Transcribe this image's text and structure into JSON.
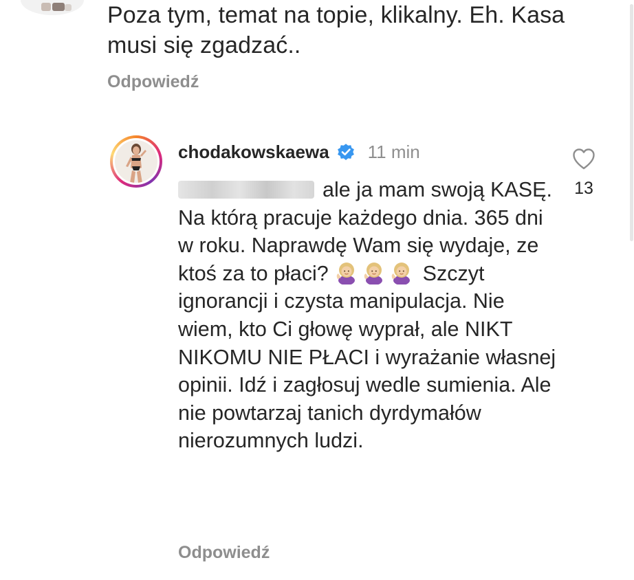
{
  "previous_comment": {
    "text": "Poza tym, temat na topie, klikalny. Eh. Kasa musi się zgadzać..",
    "reply_label": "Odpowiedź"
  },
  "comment": {
    "username": "chodakowskaewa",
    "timestamp": "11 min",
    "like_count": "13",
    "text_before_emoji": "ale ja mam swoją KASĘ. Na którą pracuje każdego dnia. 365 dni w roku. Naprawdę Wam się wydaje, ze ktoś za to płaci?",
    "emojis": [
      "woman-tipping-hand-emoji",
      "woman-tipping-hand-emoji",
      "woman-tipping-hand-emoji"
    ],
    "text_after_emoji": "Szczyt ignorancji i czysta manipulacja. Nie wiem, kto Ci głowę wyprał, ale NIKT NIKOMU NIE PŁACI i wyrażanie własnej opinii. Idź i zagłosuj wedle sumienia. Ale nie powtarzaj tanich dyrdymałów nierozumnych ludzi.",
    "reply_label": "Odpowiedź"
  },
  "icons": {
    "verified": "verified-badge-icon",
    "like": "heart-outline-icon"
  },
  "colors": {
    "text": "#262626",
    "muted": "#8e8e8e",
    "verified_blue": "#3897f0",
    "story_ring_start": "#f58529",
    "story_ring_end": "#8134af"
  }
}
